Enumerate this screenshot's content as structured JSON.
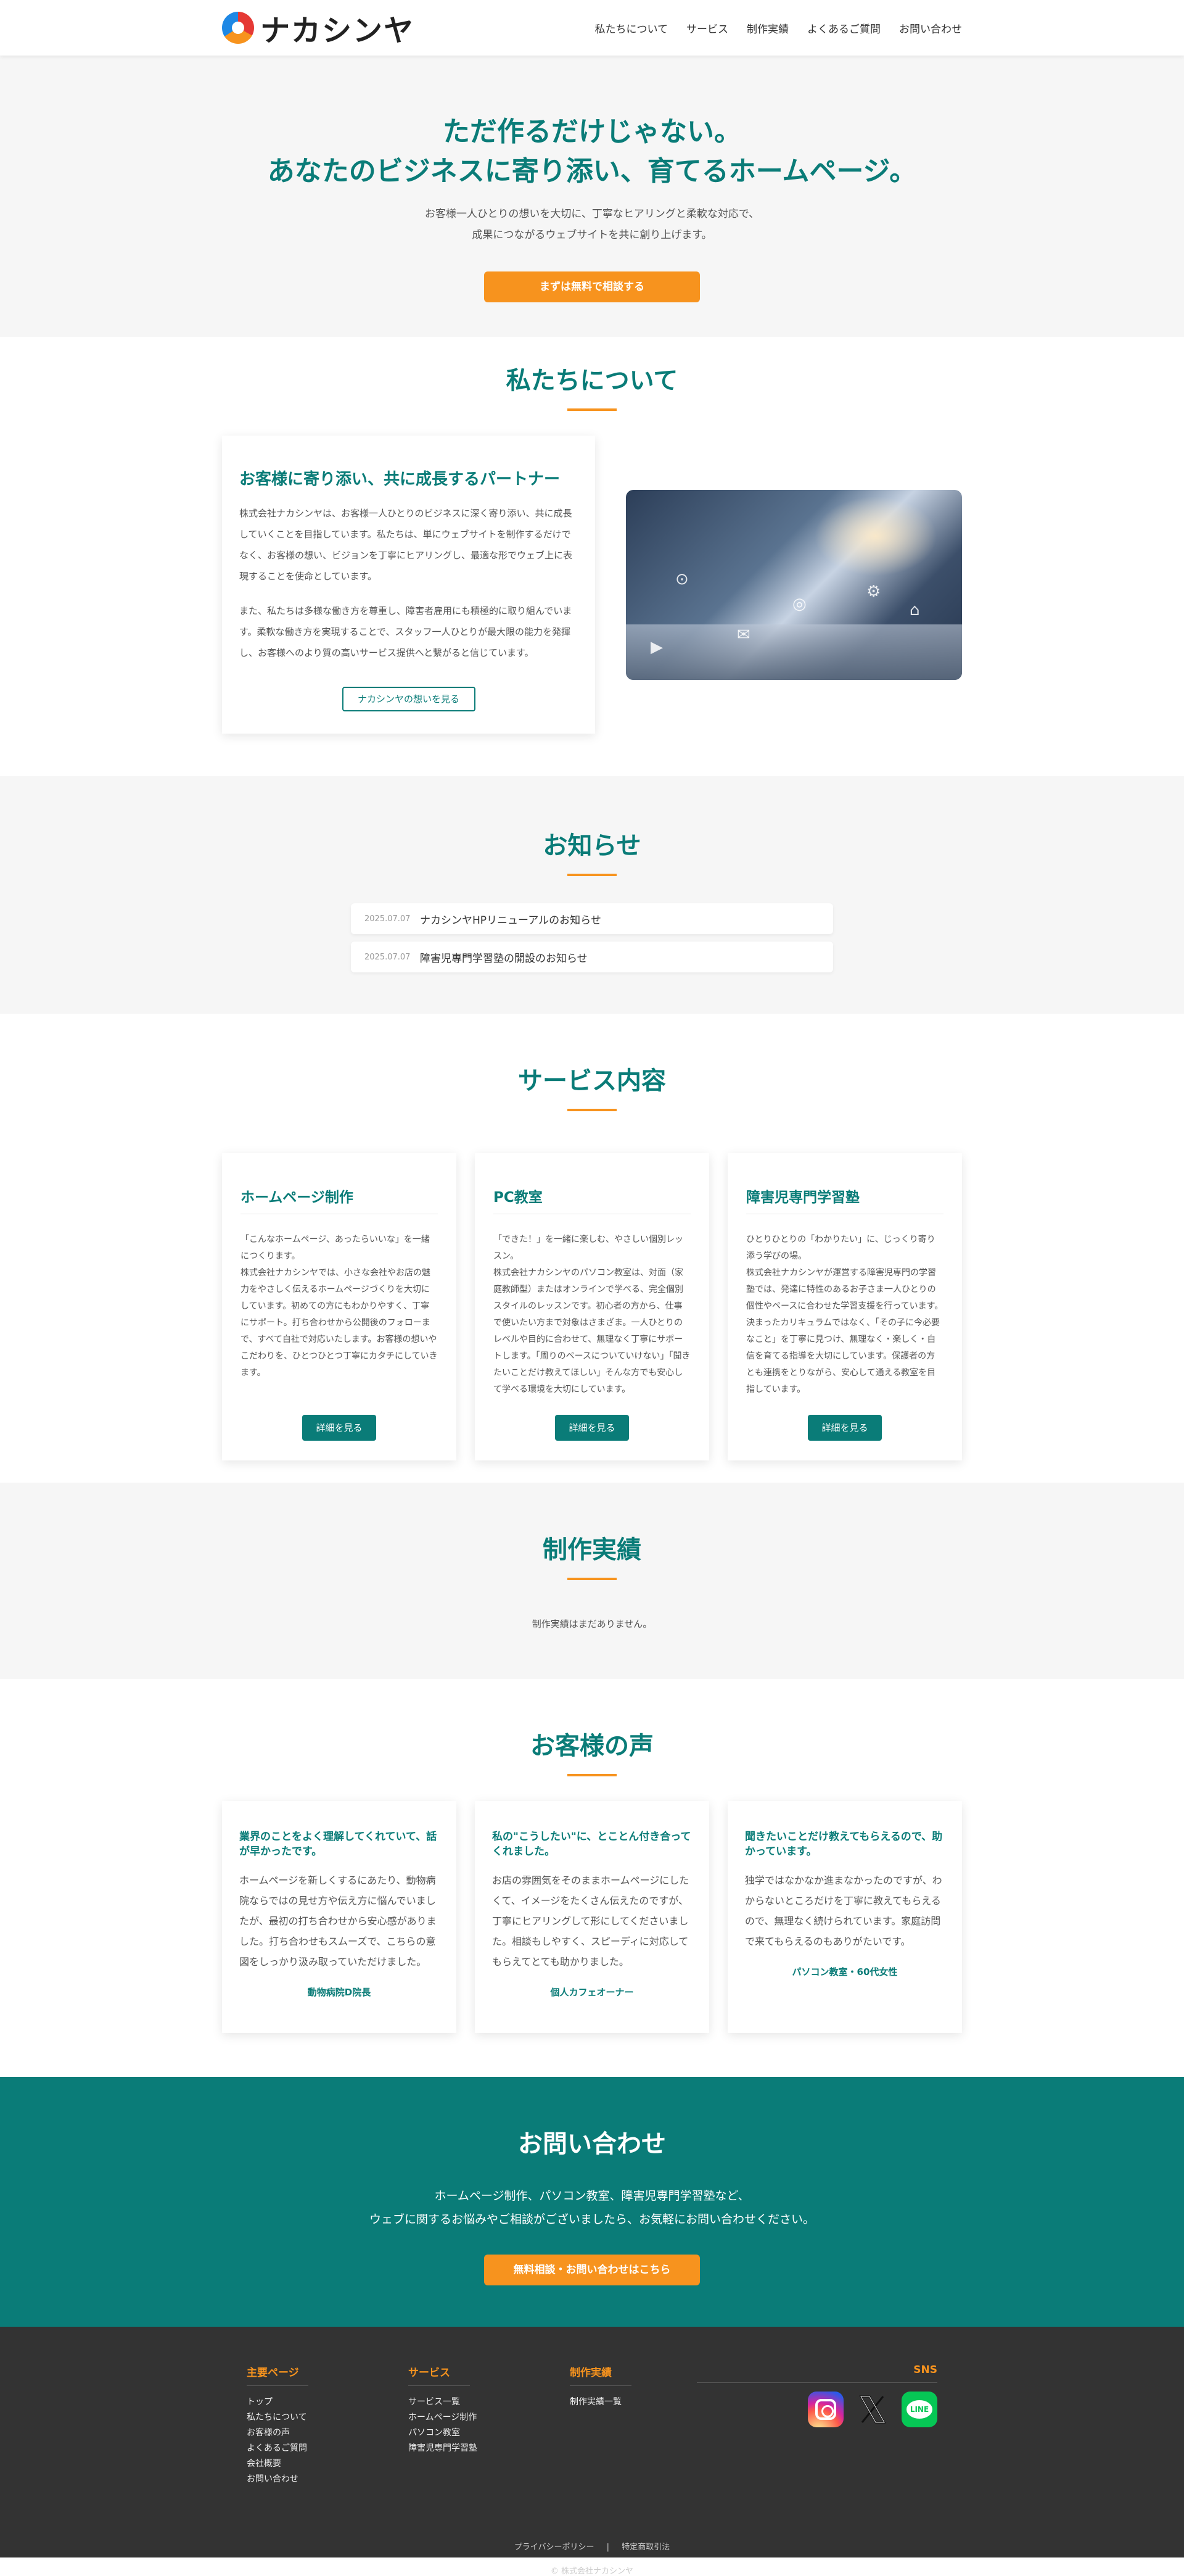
{
  "header": {
    "logo_text": "ナカシンヤ",
    "nav": [
      "私たちについて",
      "サービス",
      "制作実績",
      "よくあるご質問",
      "お問い合わせ"
    ]
  },
  "hero": {
    "title_line1": "ただ作るだけじゃない。",
    "title_line2": "あなたのビジネスに寄り添い、育てるホームページ。",
    "sub_line1": "お客様一人ひとりの想いを大切に、丁寧なヒアリングと柔軟な対応で、",
    "sub_line2": "成果につながるウェブサイトを共に創り上げます。",
    "cta": "まずは無料で相談する"
  },
  "about": {
    "title": "私たちについて",
    "card_title": "お客様に寄り添い、共に成長するパートナー",
    "para1": "株式会社ナカシンヤは、お客様一人ひとりのビジネスに深く寄り添い、共に成長していくことを目指しています。私たちは、単にウェブサイトを制作するだけでなく、お客様の想い、ビジョンを丁寧にヒアリングし、最適な形でウェブ上に表現することを使命としています。",
    "para2": "また、私たちは多様な働き方を尊重し、障害者雇用にも積極的に取り組んでいます。柔軟な働き方を実現することで、スタッフ一人ひとりが最大限の能力を発揮し、お客様へのより質の高いサービス提供へと繋がると信じています。",
    "button": "ナカシンヤの想いを見る"
  },
  "news": {
    "title": "お知らせ",
    "items": [
      {
        "date": "2025.07.07",
        "title": "ナカシンヤHPリニューアルのお知らせ"
      },
      {
        "date": "2025.07.07",
        "title": "障害児専門学習塾の開設のお知らせ"
      }
    ]
  },
  "services": {
    "title": "サービス内容",
    "cards": [
      {
        "title": "ホームページ制作",
        "text": "「こんなホームページ、あったらいいな」を一緒につくります。\n株式会社ナカシンヤでは、小さな会社やお店の魅力をやさしく伝えるホームページづくりを大切にしています。初めての方にもわかりやすく、丁寧にサポート。打ち合わせから公開後のフォローまで、すべて自社で対応いたします。お客様の想いやこだわりを、ひとつひとつ丁寧にカタチにしていきます。",
        "button": "詳細を見る"
      },
      {
        "title": "PC教室",
        "text": "「できた！」を一緒に楽しむ、やさしい個別レッスン。\n株式会社ナカシンヤのパソコン教室は、対面（家庭教師型）またはオンラインで学べる、完全個別スタイルのレッスンです。初心者の方から、仕事で使いたい方まで対象はさまざま。一人ひとりのレベルや目的に合わせて、無理なく丁寧にサポートします。「周りのペースについていけない」「聞きたいことだけ教えてほしい」そんな方でも安心して学べる環境を大切にしています。",
        "button": "詳細を見る"
      },
      {
        "title": "障害児専門学習塾",
        "text": "ひとりひとりの「わかりたい」に、じっくり寄り添う学びの場。\n株式会社ナカシンヤが運営する障害児専門の学習塾では、発達に特性のあるお子さま一人ひとりの個性やペースに合わせた学習支援を行っています。決まったカリキュラムではなく、「その子に今必要なこと」を丁寧に見つけ、無理なく・楽しく・自信を育てる指導を大切にしています。保護者の方とも連携をとりながら、安心して通える教室を目指しています。",
        "button": "詳細を見る"
      }
    ]
  },
  "works": {
    "title": "制作実績",
    "empty": "制作実績はまだありません。"
  },
  "voice": {
    "title": "お客様の声",
    "cards": [
      {
        "headline": "業界のことをよく理解してくれていて、話が早かったです。",
        "text": "ホームページを新しくするにあたり、動物病院ならではの見せ方や伝え方に悩んでいましたが、最初の打ち合わせから安心感がありました。打ち合わせもスムーズで、こちらの意図をしっかり汲み取っていただけました。",
        "who": "動物病院D院長"
      },
      {
        "headline": "私の\"こうしたい\"に、とことん付き合ってくれました。",
        "text": "お店の雰囲気をそのままホームページにしたくて、イメージをたくさん伝えたのですが、丁寧にヒアリングして形にしてくださいました。相談もしやすく、スピーディに対応してもらえてとても助かりました。",
        "who": "個人カフェオーナー"
      },
      {
        "headline": "聞きたいことだけ教えてもらえるので、助かっています。",
        "text": "独学ではなかなか進まなかったのですが、わからないところだけを丁寧に教えてもらえるので、無理なく続けられています。家庭訪問で来てもらえるのもありがたいです。",
        "who": "パソコン教室・60代女性"
      }
    ]
  },
  "cta": {
    "title": "お問い合わせ",
    "line1": "ホームページ制作、パソコン教室、障害児専門学習塾など、",
    "line2": "ウェブに関するお悩みやご相談がございましたら、お気軽にお問い合わせください。",
    "button": "無料相談・お問い合わせはこちら"
  },
  "footer": {
    "cols": [
      {
        "title": "主要ページ",
        "items": [
          "トップ",
          "私たちについて",
          "お客様の声",
          "よくあるご質問",
          "会社概要",
          "お問い合わせ"
        ]
      },
      {
        "title": "サービス",
        "items": [
          "サービス一覧",
          "ホームページ制作",
          "パソコン教室",
          "障害児専門学習塾"
        ]
      },
      {
        "title": "制作実績",
        "items": [
          "制作実績一覧"
        ]
      }
    ],
    "sns_title": "SNS",
    "line_label": "LINE",
    "privacy": "プライバシーポリシー",
    "separator": "|",
    "tokusho": "特定商取引法",
    "copyright": "© 株式会社ナカシンヤ"
  },
  "colors": {
    "primary": "#0a7c78",
    "accent": "#f7931e",
    "footer": "#333333"
  },
  "icons": [
    "logo-mark-icon",
    "instagram-icon",
    "x-icon",
    "line-icon"
  ]
}
